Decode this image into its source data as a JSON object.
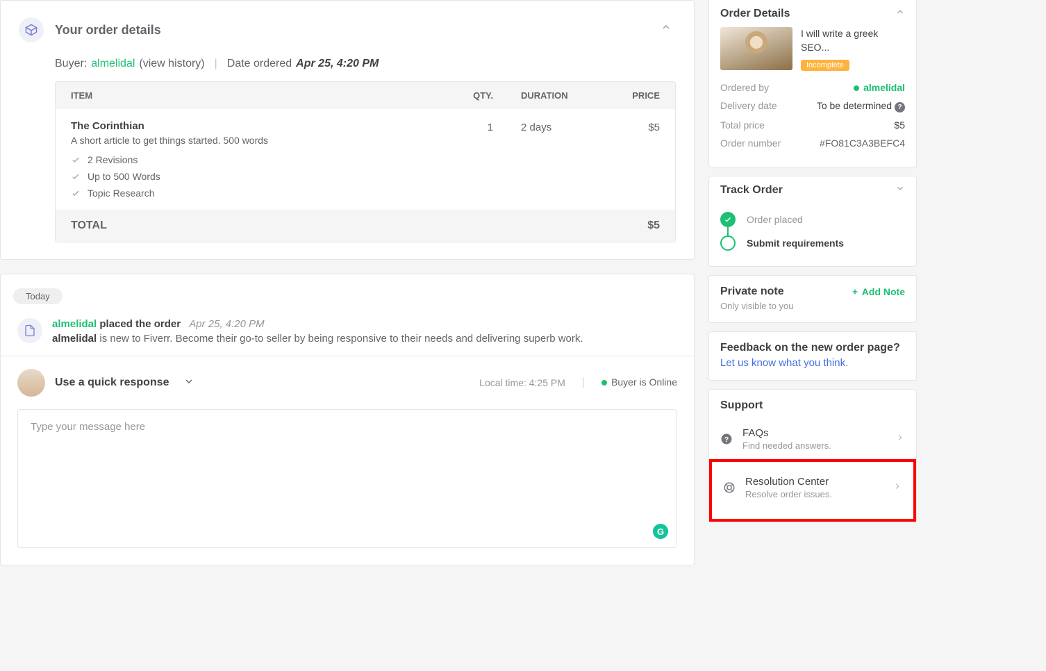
{
  "order_details": {
    "title": "Your order details",
    "buyer_label": "Buyer:",
    "buyer_name": "almelidal",
    "view_history": "(view history)",
    "date_label": "Date ordered",
    "date_value": "Apr 25, 4:20 PM",
    "headers": {
      "item": "ITEM",
      "qty": "QTY.",
      "duration": "DURATION",
      "price": "PRICE"
    },
    "item": {
      "name": "The Corinthian",
      "desc": "A short article to get things started. 500 words",
      "qty": "1",
      "duration": "2 days",
      "price": "$5",
      "features": [
        "2 Revisions",
        "Up to 500 Words",
        "Topic Research"
      ]
    },
    "total_label": "TOTAL",
    "total_value": "$5"
  },
  "activity": {
    "today": "Today",
    "buyer": "almelidal",
    "action": "placed the order",
    "time": "Apr 25, 4:20 PM",
    "tip_b": "almelidal",
    "tip_rest": " is new to Fiverr. Become their go-to seller by being responsive to their needs and delivering superb work."
  },
  "quick": {
    "label": "Use a quick response",
    "local_time": "Local time: 4:25 PM",
    "online": "Buyer is Online",
    "placeholder": "Type your message here"
  },
  "sidebar": {
    "details": {
      "title": "Order Details",
      "gig_title": "I will write a greek SEO...",
      "badge": "Incomplete",
      "ordered_by_label": "Ordered by",
      "ordered_by": "almelidal",
      "delivery_label": "Delivery date",
      "delivery_val": "To be determined",
      "price_label": "Total price",
      "price_val": "$5",
      "ordnum_label": "Order number",
      "ordnum_val": "#FO81C3A3BEFC4"
    },
    "track": {
      "title": "Track Order",
      "step1": "Order placed",
      "step2": "Submit requirements"
    },
    "note": {
      "title": "Private note",
      "add": "Add Note",
      "sub": "Only visible to you"
    },
    "feedback": {
      "title": "Feedback on the new order page?",
      "link": "Let us know what you think"
    },
    "support": {
      "title": "Support",
      "faq_title": "FAQs",
      "faq_desc": "Find needed answers.",
      "res_title": "Resolution Center",
      "res_desc": "Resolve order issues."
    }
  }
}
